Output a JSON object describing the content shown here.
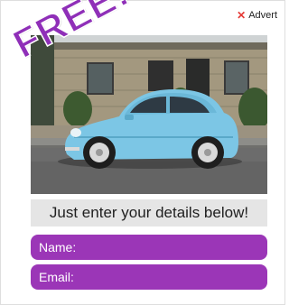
{
  "ad": {
    "close_label": "Advert",
    "close_icon": "close-icon",
    "promo_text": "FREE!",
    "image_alt": "Light blue Fiat 500 parked in front of a stone building",
    "headline": "Just enter your details below!"
  },
  "form": {
    "name_placeholder": "Name:",
    "email_placeholder": "Email:"
  },
  "colors": {
    "accent": "#9b36b7",
    "promo": "#8f2fb8",
    "close_x": "#e53935",
    "banner_bg": "#e5e5e5"
  }
}
